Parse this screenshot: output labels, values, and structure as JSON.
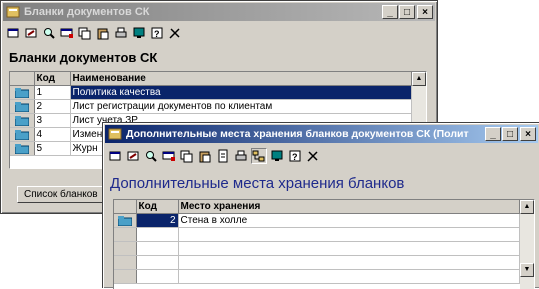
{
  "win1": {
    "title": "Бланки документов СК",
    "heading": "Бланки документов СК",
    "columns": [
      "Код",
      "Наименование"
    ],
    "rows": [
      {
        "code": "1",
        "name": "Политика качества"
      },
      {
        "code": "2",
        "name": "Лист регистрации документов по клиентам"
      },
      {
        "code": "3",
        "name": "Лист учета ЗР"
      },
      {
        "code": "4",
        "name": "Измен"
      },
      {
        "code": "5",
        "name": "Журн"
      }
    ],
    "tab_label": "Список бланков"
  },
  "win2": {
    "title": "Дополнительные места хранения бланков документов СК (Полит",
    "heading": "Дополнительные места хранения бланков",
    "columns": [
      "Код",
      "Место хранения"
    ],
    "rows": [
      {
        "code": "2",
        "name": "Стена в холле"
      }
    ]
  },
  "caption_buttons": {
    "minimize": "_",
    "maximize": "□",
    "close": "×"
  },
  "colors": {
    "active_title": "#0a246a",
    "window_face": "#d4d0c8",
    "heading_blue": "#1f2a8c",
    "selection": "#0a246a"
  }
}
